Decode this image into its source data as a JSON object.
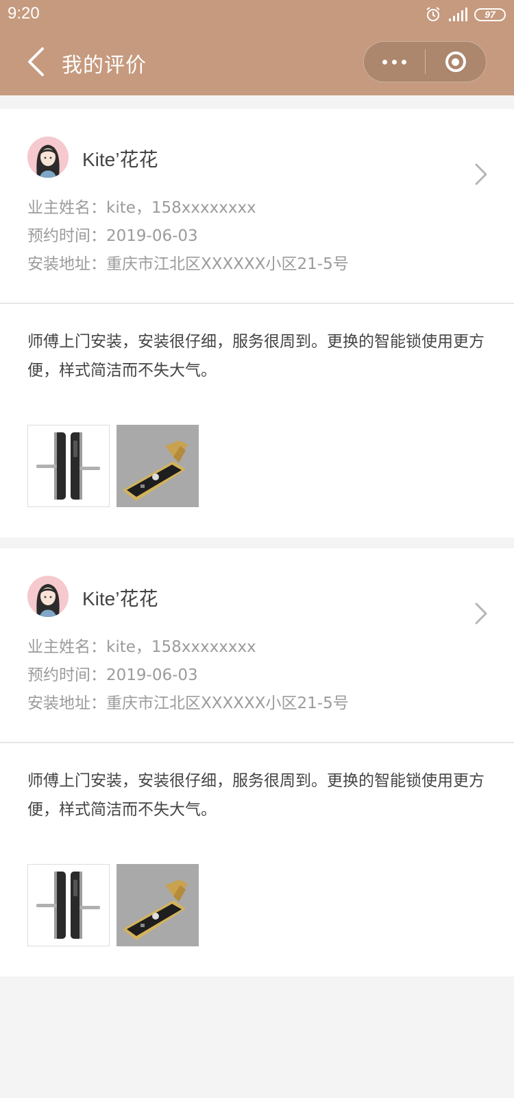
{
  "status_bar": {
    "time": "9:20",
    "battery": "97"
  },
  "nav": {
    "title": "我的评价"
  },
  "reviews": [
    {
      "user_name": "Kite’花花",
      "owner_label": "业主姓名：",
      "owner_value": "kite，158xxxxxxxx",
      "time_label": "预约时间：",
      "time_value": "2019-06-03",
      "address_label": "安装地址：",
      "address_value": "重庆市江北区XXXXXX小区21-5号",
      "comment": "师傅上门安装，安装很仔细，服务很周到。更换的智能锁使用更方便，样式简洁而不失大气。"
    },
    {
      "user_name": "Kite’花花",
      "owner_label": "业主姓名：",
      "owner_value": "kite，158xxxxxxxx",
      "time_label": "预约时间：",
      "time_value": "2019-06-03",
      "address_label": "安装地址：",
      "address_value": "重庆市江北区XXXXXX小区21-5号",
      "comment": "师傅上门安装，安装很仔细，服务很周到。更换的智能锁使用更方便，样式简洁而不失大气。"
    }
  ],
  "colors": {
    "header_bg": "#c69a7e",
    "page_bg": "#f4f4f4",
    "muted_text": "#9b9b9b",
    "body_text": "#444444"
  }
}
